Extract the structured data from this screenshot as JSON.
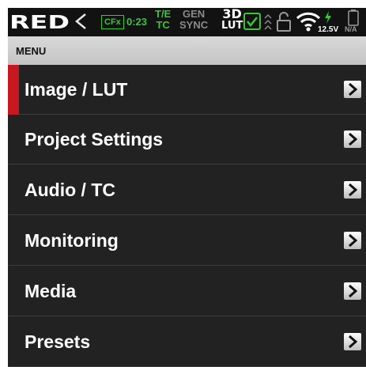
{
  "status": {
    "brand": "RED",
    "back_icon": "chevron-left-icon",
    "media_label": "CFx",
    "media_time": "0:23",
    "timecode_top": "T/E",
    "timecode_bottom": "TC",
    "sync_top": "GEN",
    "sync_bottom": "SYNC",
    "lut_top": "3D",
    "lut_bottom": "LUT",
    "voltage": "12.5V",
    "battery": "N/A",
    "accent_green": "#37c837"
  },
  "menu": {
    "title": "MENU",
    "items": [
      {
        "label": "Image / LUT",
        "selected": true
      },
      {
        "label": "Project Settings"
      },
      {
        "label": "Audio / TC"
      },
      {
        "label": "Monitoring"
      },
      {
        "label": "Media"
      },
      {
        "label": "Presets"
      }
    ],
    "selected_color": "#c8181f"
  }
}
